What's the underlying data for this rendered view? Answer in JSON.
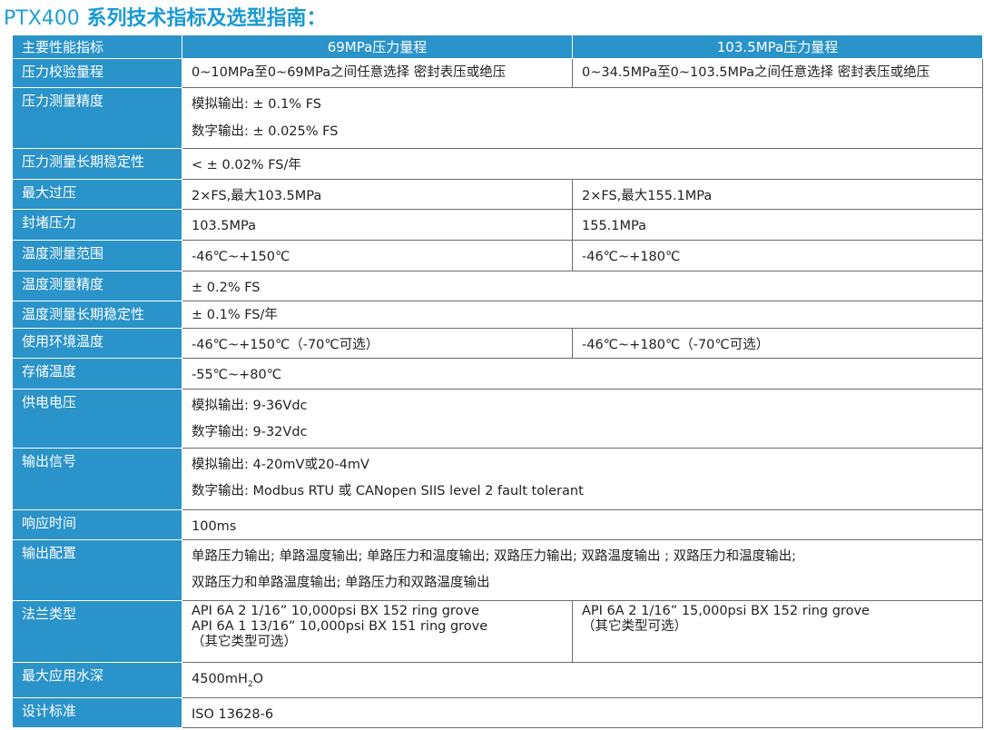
{
  "title": {
    "model": "PTX400",
    "rest": " 系列技术指标及选型指南："
  },
  "header": {
    "label": "主要性能指标",
    "col1": "69MPa压力量程",
    "col2": "103.5MPa压力量程"
  },
  "rows": [
    {
      "label": "压力校验量程",
      "col1": [
        "0~10MPa至0~69MPa之间任意选择 密封表压或绝压"
      ],
      "col2": [
        "0~34.5MPa至0~103.5MPa之间任意选择 密封表压或绝压"
      ]
    },
    {
      "label": "压力测量精度",
      "span": [
        "模拟输出: ± 0.1% FS",
        "数字输出: ± 0.025% FS"
      ]
    },
    {
      "label": "压力测量长期稳定性",
      "span": [
        "< ± 0.02% FS/年"
      ]
    },
    {
      "label": "最大过压",
      "col1": [
        "2×FS,最大103.5MPa"
      ],
      "col2": [
        "2×FS,最大155.1MPa"
      ]
    },
    {
      "label": "封堵压力",
      "col1": [
        "103.5MPa"
      ],
      "col2": [
        "155.1MPa"
      ]
    },
    {
      "label": "温度测量范围",
      "col1": [
        "-46℃~+150℃"
      ],
      "col2": [
        "-46℃~+180℃"
      ]
    },
    {
      "label": "温度测量精度",
      "span": [
        "± 0.2% FS"
      ]
    },
    {
      "label": "温度测量长期稳定性",
      "span": [
        "± 0.1% FS/年"
      ]
    },
    {
      "label": "使用环境温度",
      "col1": [
        "-46℃~+150℃（-70℃可选）"
      ],
      "col2": [
        "-46℃~+180℃（-70℃可选）"
      ]
    },
    {
      "label": "存储温度",
      "span": [
        "-55℃~+80℃"
      ]
    },
    {
      "label": "供电电压",
      "span": [
        "模拟输出:  9-36Vdc",
        "数字输出:  9-32Vdc"
      ]
    },
    {
      "label": "输出信号",
      "span": [
        "模拟输出:  4-20mV或20-4mV",
        "数字输出:  Modbus RTU 或 CANopen SIIS level 2 fault tolerant"
      ]
    },
    {
      "label": "响应时间",
      "span": [
        "100ms"
      ]
    },
    {
      "label": "输出配置",
      "span": [
        "单路压力输出; 单路温度输出; 单路压力和温度输出; 双路压力输出;  双路温度输出 ;  双路压力和温度输出;",
        "双路压力和单路温度输出; 单路压力和双路温度输出"
      ]
    },
    {
      "label": "法兰类型",
      "col1": [
        "API 6A 2 1/16” 10,000psi BX 152 ring grove",
        "API 6A 1 13/16” 10,000psi BX 151 ring grove",
        "（其它类型可选）"
      ],
      "col2": [
        "API 6A 2 1/16” 15,000psi BX 152 ring grove",
        "（其它类型可选）"
      ]
    },
    {
      "label": "最大应用水深",
      "span_main": "4500mH",
      "span_sub": "2",
      "span_tail": "O"
    },
    {
      "label": "设计标准",
      "span": [
        "ISO 13628-6"
      ]
    }
  ]
}
